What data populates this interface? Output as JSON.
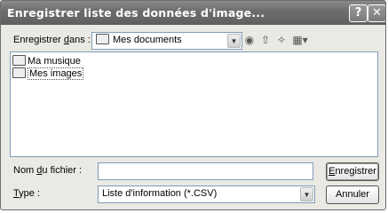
{
  "window": {
    "title": "Enregistrer liste des données d'image...",
    "help_glyph": "?",
    "close_glyph": "✕"
  },
  "save_in": {
    "label_pre": "Enregistrer ",
    "label_ul": "d",
    "label_post": "ans :",
    "value": "Mes documents"
  },
  "toolbar": {
    "back_icon": "back-icon",
    "up_icon": "up-folder-icon",
    "new_folder_icon": "new-folder-icon",
    "views_icon": "views-menu-icon"
  },
  "files": {
    "items": [
      {
        "name": "Ma musique",
        "icon": "music-folder-icon"
      },
      {
        "name": "Mes images",
        "icon": "folder-icon"
      }
    ]
  },
  "filename": {
    "label_pre": "Nom ",
    "label_ul": "d",
    "label_post": "u fichier :",
    "value": ""
  },
  "filetype": {
    "label_ul": "T",
    "label_post": "ype :",
    "value": "Liste d'information (*.CSV)"
  },
  "buttons": {
    "save_ul": "E",
    "save_rest": "nregistrer",
    "cancel": "Annuler"
  }
}
